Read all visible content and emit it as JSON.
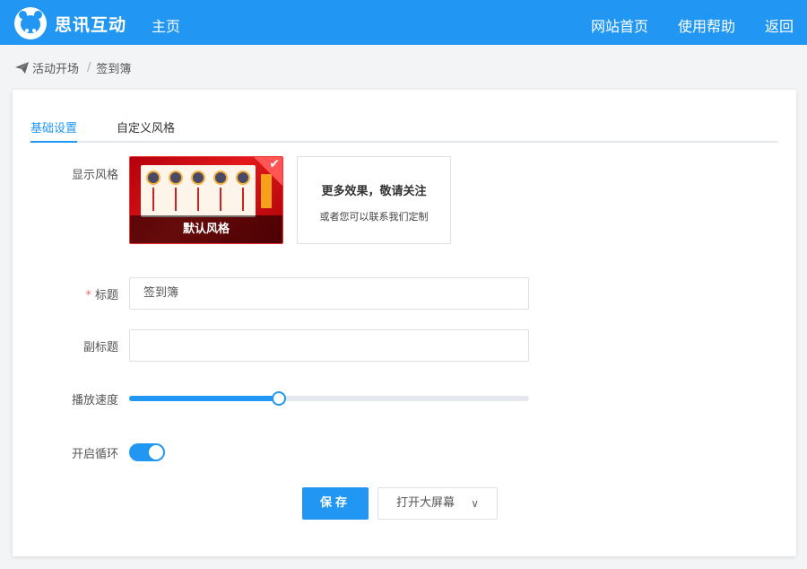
{
  "header": {
    "brand": "思讯互动",
    "nav_home": "主页",
    "nav_links": [
      "网站首页",
      "使用帮助",
      "返回"
    ]
  },
  "breadcrumb": {
    "items": [
      "活动开场",
      "签到簿"
    ],
    "separator": "/"
  },
  "tabs": [
    {
      "label": "基础设置",
      "active": true
    },
    {
      "label": "自定义风格",
      "active": false
    }
  ],
  "form": {
    "display_style_label": "显示风格",
    "style_default_caption": "默认风格",
    "style_more_title": "更多效果，敬请关注",
    "style_more_subtitle": "或者您可以联系我们定制",
    "title_label": "标题",
    "title_required_mark": "*",
    "title_value": "签到簿",
    "subtitle_label": "副标题",
    "subtitle_value": "",
    "speed_label": "播放速度",
    "speed_fraction": 0.375,
    "loop_label": "开启循环",
    "loop_enabled": true
  },
  "actions": {
    "save_label": "保存",
    "open_screen_label": "打开大屏幕"
  },
  "colors": {
    "accent": "#2196f3",
    "required": "#f56c6c"
  }
}
